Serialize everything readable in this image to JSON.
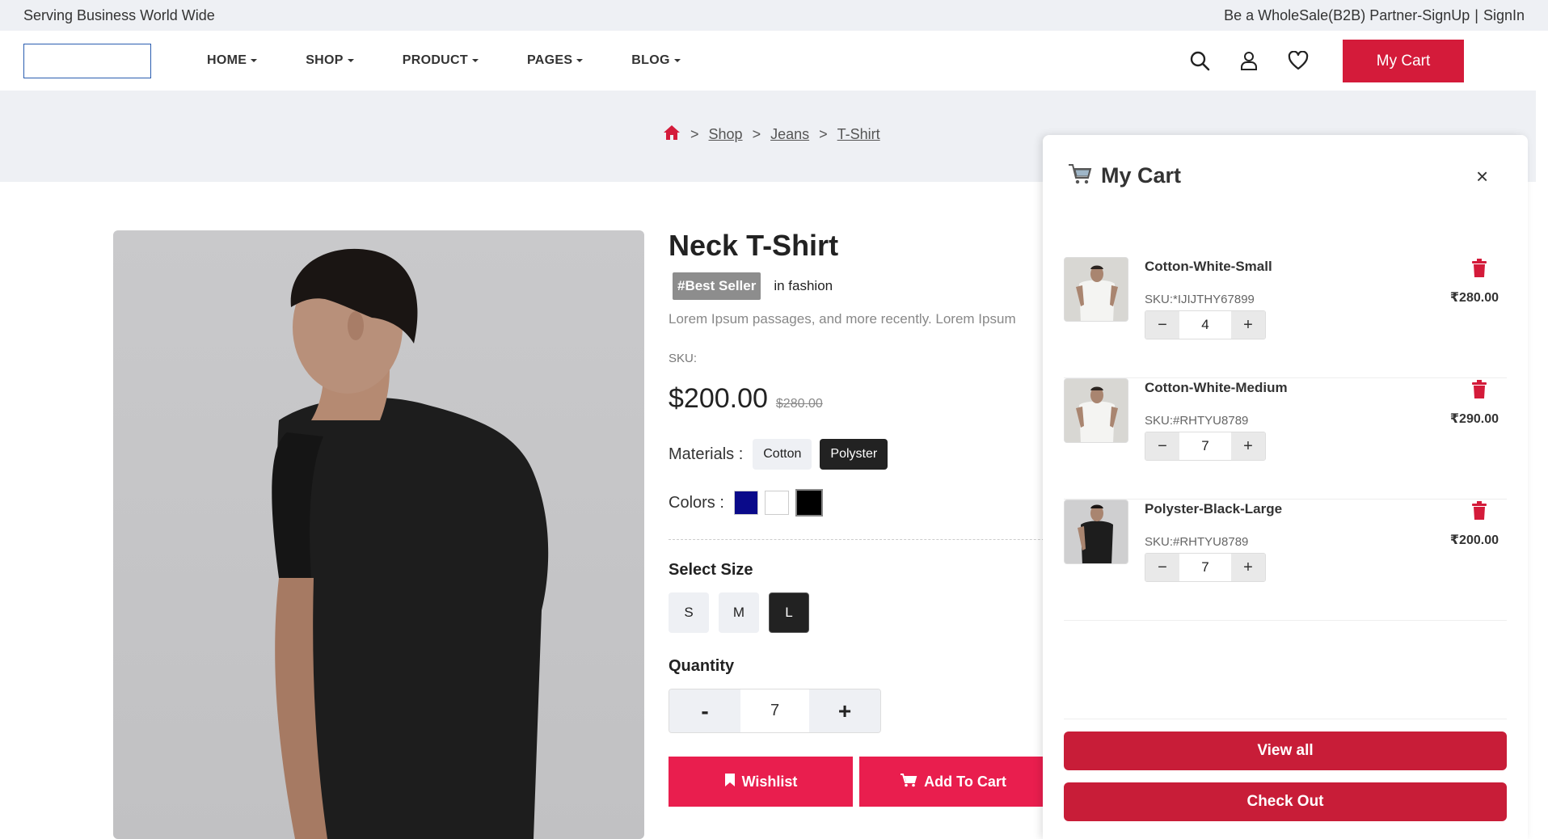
{
  "topbar": {
    "left_text": "Serving Business World Wide",
    "partner_text": "Be a WholeSale(B2B) Partner-SignUp",
    "divider": "|",
    "signin": "SignIn"
  },
  "nav": {
    "items": [
      {
        "label": "HOME"
      },
      {
        "label": "SHOP"
      },
      {
        "label": "PRODUCT"
      },
      {
        "label": "PAGES"
      },
      {
        "label": "BLOG"
      }
    ],
    "icons": [
      "search-icon",
      "user-icon",
      "heart-icon"
    ],
    "cart_button": "My Cart"
  },
  "breadcrumb": {
    "items": [
      "Shop",
      "Jeans",
      "T-Shirt"
    ],
    "separator": ">"
  },
  "product": {
    "title": "Neck T-Shirt",
    "badge": "#Best Seller",
    "badge_suffix": "in fashion",
    "description": "Lorem Ipsum passages, and more recently. Lorem Ipsum",
    "sku_label": "SKU:",
    "price": "$200.00",
    "old_price": "$280.00",
    "materials_label": "Materials :",
    "materials": [
      "Cotton",
      "Polyster"
    ],
    "selected_material": "Polyster",
    "colors_label": "Colors :",
    "colors": [
      "#0a0a8a",
      "#ffffff",
      "#000000"
    ],
    "size_title": "Select Size",
    "sizes": [
      "S",
      "M",
      "L"
    ],
    "selected_size": "L",
    "quantity_title": "Quantity",
    "quantity": "7",
    "qty_minus": "-",
    "qty_plus": "+",
    "wishlist_label": "Wishlist",
    "add_to_cart_label": "Add To Cart"
  },
  "cart": {
    "title": "My Cart",
    "close": "×",
    "items": [
      {
        "name": "Cotton-White-Small",
        "sku": "SKU:*IJIJTHY67899",
        "qty": "4",
        "price": "₹280.00",
        "shirt": "white"
      },
      {
        "name": "Cotton-White-Medium",
        "sku": "SKU:#RHTYU8789",
        "qty": "7",
        "price": "₹290.00",
        "shirt": "white"
      },
      {
        "name": "Polyster-Black-Large",
        "sku": "SKU:#RHTYU8789",
        "qty": "7",
        "price": "₹200.00",
        "shirt": "black"
      }
    ],
    "qty_minus": "−",
    "qty_plus": "+",
    "view_all": "View all",
    "checkout": "Check Out"
  },
  "colors": {
    "accent": "#d41b3a",
    "action_pink": "#e91e4e",
    "drawer_button": "#c81d38",
    "band": "#eef0f4"
  }
}
